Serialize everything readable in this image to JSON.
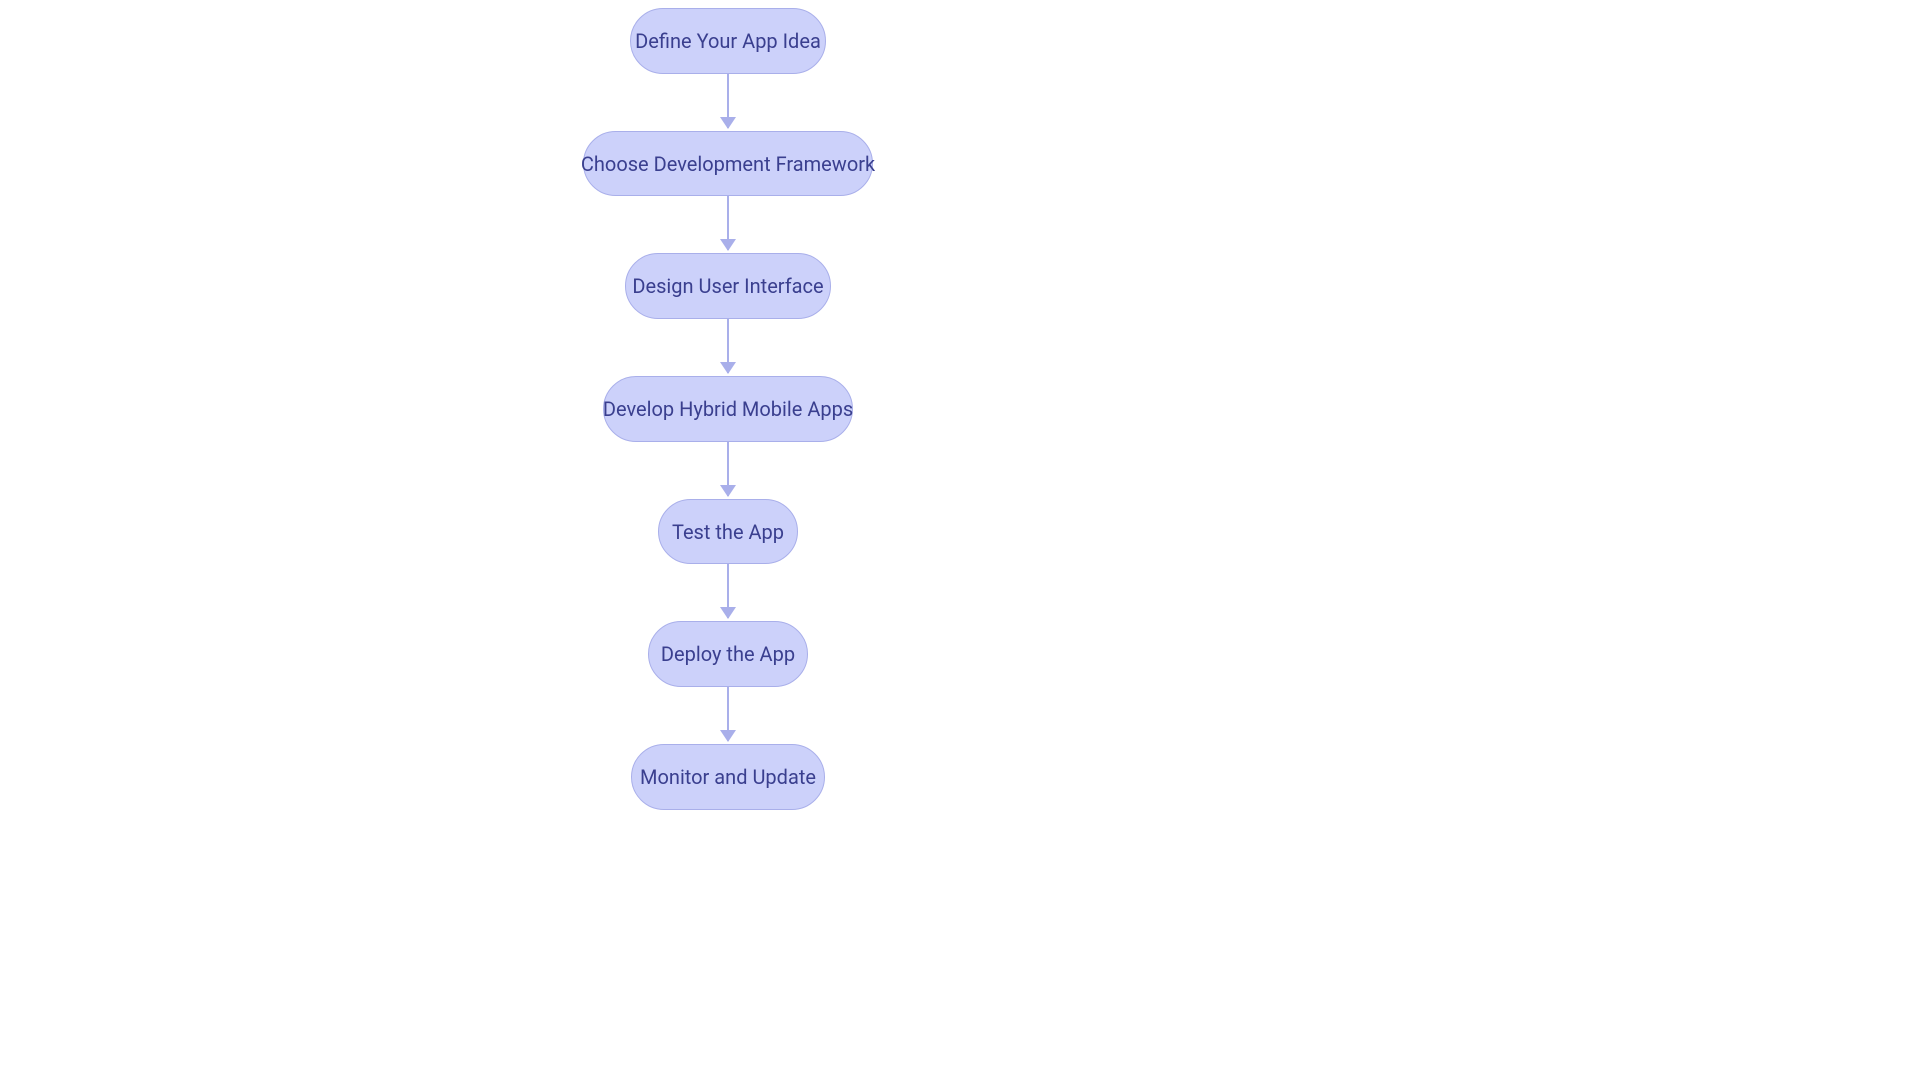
{
  "diagram": {
    "type": "flowchart-vertical",
    "theme": {
      "node_fill": "#ccd1fa",
      "node_stroke": "#a9afea",
      "node_text": "#3a3f8f",
      "arrow_color": "#a9afea",
      "background": "#ffffff"
    },
    "nodes": [
      {
        "id": "n1",
        "label": "Define Your App Idea"
      },
      {
        "id": "n2",
        "label": "Choose Development Framework"
      },
      {
        "id": "n3",
        "label": "Design User Interface"
      },
      {
        "id": "n4",
        "label": "Develop Hybrid Mobile Apps"
      },
      {
        "id": "n5",
        "label": "Test the App"
      },
      {
        "id": "n6",
        "label": "Deploy the App"
      },
      {
        "id": "n7",
        "label": "Monitor and Update"
      }
    ],
    "edges": [
      {
        "from": "n1",
        "to": "n2"
      },
      {
        "from": "n2",
        "to": "n3"
      },
      {
        "from": "n3",
        "to": "n4"
      },
      {
        "from": "n4",
        "to": "n5"
      },
      {
        "from": "n5",
        "to": "n6"
      },
      {
        "from": "n6",
        "to": "n7"
      }
    ]
  }
}
